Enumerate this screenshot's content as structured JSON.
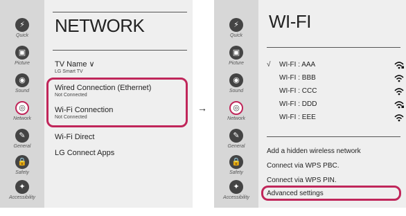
{
  "left": {
    "title": "NETWORK",
    "sidebar": [
      {
        "icon": "quick-icon",
        "glyph": "⚡",
        "label": "Quick"
      },
      {
        "icon": "picture-icon",
        "glyph": "▣",
        "label": "Picture"
      },
      {
        "icon": "sound-icon",
        "glyph": "◉",
        "label": "Sound"
      },
      {
        "icon": "network-icon",
        "glyph": "◎",
        "label": "Network",
        "active": true
      },
      {
        "icon": "general-icon",
        "glyph": "✎",
        "label": "General"
      },
      {
        "icon": "safety-icon",
        "glyph": "🔒",
        "label": "Safety"
      },
      {
        "icon": "accessibility-icon",
        "glyph": "✦",
        "label": "Accessibility"
      }
    ],
    "items": [
      {
        "label": "TV Name ∨",
        "sub": "LG Smart TV"
      },
      {
        "label": "Wired Connection (Ethernet)",
        "sub": "Not Connected"
      },
      {
        "label": "Wi-Fi Connection",
        "sub": "Not Connected"
      },
      {
        "label": "Wi-Fi Direct",
        "sub": ""
      },
      {
        "label": "LG Connect Apps",
        "sub": ""
      }
    ]
  },
  "arrow": "→",
  "right": {
    "title": "WI-FI",
    "sidebar": [
      {
        "icon": "quick-icon",
        "glyph": "⚡",
        "label": "Quick"
      },
      {
        "icon": "picture-icon",
        "glyph": "▣",
        "label": "Picture"
      },
      {
        "icon": "sound-icon",
        "glyph": "◉",
        "label": "Sound"
      },
      {
        "icon": "network-icon",
        "glyph": "◎",
        "label": "Network",
        "active": true
      },
      {
        "icon": "general-icon",
        "glyph": "✎",
        "label": "General"
      },
      {
        "icon": "safety-icon",
        "glyph": "🔒",
        "label": "Safety"
      },
      {
        "icon": "accessibility-icon",
        "glyph": "✦",
        "label": "Accessibility"
      }
    ],
    "networks": [
      {
        "check": "√",
        "name": "WI-FI : AAA",
        "locked": true
      },
      {
        "check": "",
        "name": "WI-FI : BBB",
        "locked": false
      },
      {
        "check": "",
        "name": "WI-FI : CCC",
        "locked": false
      },
      {
        "check": "",
        "name": "WI-FI : DDD",
        "locked": true
      },
      {
        "check": "",
        "name": "WI-FI : EEE",
        "locked": false
      }
    ],
    "options": [
      "Add a hidden wireless network",
      "Connect via WPS PBC.",
      "Connect via WPS PIN.",
      "Advanced settings"
    ]
  },
  "colors": {
    "highlight": "#c0265a",
    "sidebar_bg": "#d7d7d7",
    "content_bg": "#efefef"
  }
}
